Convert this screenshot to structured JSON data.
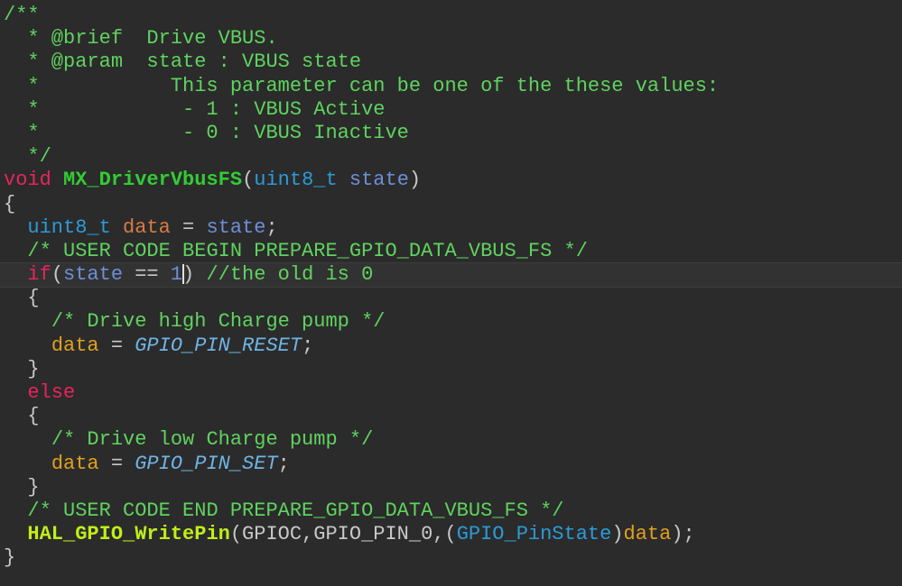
{
  "editor": {
    "current_line": 12,
    "colors": {
      "background": "#2b2b2b",
      "comment": "#5fd35f",
      "keyword": "#e8245c",
      "function": "#33cc33",
      "type": "#2b9bd8",
      "parameter": "#6d8fd9",
      "variable": "#e0a020",
      "macro": "#6fb4e6",
      "call": "#bfee1a"
    },
    "lines": [
      [
        [
          "comment",
          "/**"
        ]
      ],
      [
        [
          "comment",
          "  * @brief  Drive VBUS."
        ]
      ],
      [
        [
          "comment",
          "  * @param  state : VBUS state"
        ]
      ],
      [
        [
          "comment",
          "  *           This parameter can be one of the these values:"
        ]
      ],
      [
        [
          "comment",
          "  *            - 1 : VBUS Active"
        ]
      ],
      [
        [
          "comment",
          "  *            - 0 : VBUS Inactive"
        ]
      ],
      [
        [
          "comment",
          "  */"
        ]
      ],
      [
        [
          "keyword",
          "void"
        ],
        [
          "plain",
          " "
        ],
        [
          "func",
          "MX_DriverVbusFS"
        ],
        [
          "plain",
          "("
        ],
        [
          "type",
          "uint8_t"
        ],
        [
          "plain",
          " "
        ],
        [
          "param",
          "state"
        ],
        [
          "plain",
          ")"
        ]
      ],
      [
        [
          "plain",
          "{"
        ]
      ],
      [
        [
          "plain",
          "  "
        ],
        [
          "type",
          "uint8_t"
        ],
        [
          "plain",
          " "
        ],
        [
          "local",
          "data"
        ],
        [
          "plain",
          " = "
        ],
        [
          "param",
          "state"
        ],
        [
          "plain",
          ";"
        ]
      ],
      [
        [
          "plain",
          "  "
        ],
        [
          "comment",
          "/* USER CODE BEGIN PREPARE_GPIO_DATA_VBUS_FS */"
        ]
      ],
      [
        [
          "plain",
          "  "
        ],
        [
          "keyword",
          "if"
        ],
        [
          "plain",
          "("
        ],
        [
          "param",
          "state"
        ],
        [
          "plain",
          " == "
        ],
        [
          "number",
          "1"
        ],
        [
          "cursor",
          ""
        ],
        [
          "plain",
          ") "
        ],
        [
          "comment",
          "//the old is 0"
        ]
      ],
      [
        [
          "plain",
          "  {"
        ]
      ],
      [
        [
          "plain",
          "    "
        ],
        [
          "comment",
          "/* Drive high Charge pump */"
        ]
      ],
      [
        [
          "plain",
          "    "
        ],
        [
          "var",
          "data"
        ],
        [
          "plain",
          " = "
        ],
        [
          "macro",
          "GPIO_PIN_RESET"
        ],
        [
          "plain",
          ";"
        ]
      ],
      [
        [
          "plain",
          "  }"
        ]
      ],
      [
        [
          "plain",
          "  "
        ],
        [
          "keyword",
          "else"
        ]
      ],
      [
        [
          "plain",
          "  {"
        ]
      ],
      [
        [
          "plain",
          "    "
        ],
        [
          "comment",
          "/* Drive low Charge pump */"
        ]
      ],
      [
        [
          "plain",
          "    "
        ],
        [
          "var",
          "data"
        ],
        [
          "plain",
          " = "
        ],
        [
          "macro",
          "GPIO_PIN_SET"
        ],
        [
          "plain",
          ";"
        ]
      ],
      [
        [
          "plain",
          "  }"
        ]
      ],
      [
        [
          "plain",
          "  "
        ],
        [
          "comment",
          "/* USER CODE END PREPARE_GPIO_DATA_VBUS_FS */"
        ]
      ],
      [
        [
          "plain",
          "  "
        ],
        [
          "call",
          "HAL_GPIO_WritePin"
        ],
        [
          "plain",
          "(GPIOC,GPIO_PIN_0,("
        ],
        [
          "type",
          "GPIO_PinState"
        ],
        [
          "plain",
          ")"
        ],
        [
          "var",
          "data"
        ],
        [
          "plain",
          ");"
        ]
      ],
      [
        [
          "plain",
          "}"
        ]
      ]
    ]
  }
}
